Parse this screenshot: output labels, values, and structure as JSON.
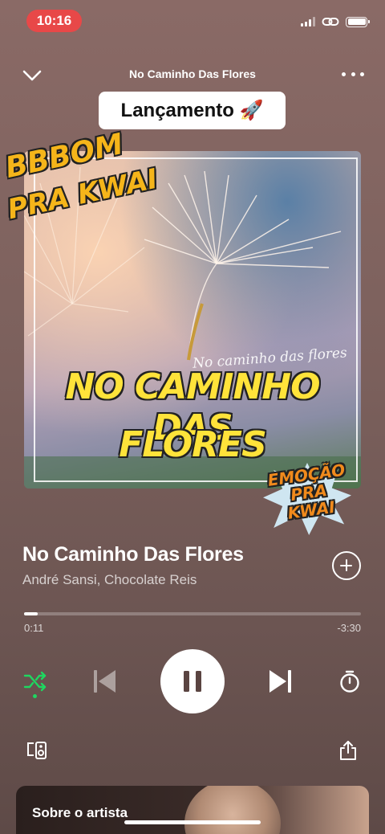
{
  "status_bar": {
    "time": "10:16"
  },
  "header": {
    "title": "No Caminho Das Flores"
  },
  "badge": {
    "label": "Lançamento 🚀"
  },
  "cover": {
    "script_text": "No caminho das flores",
    "title_line1": "NO CAMINHO DAS",
    "title_line2": "FLORES",
    "sticker_top_line1": "BBBOM",
    "sticker_top_line2": "PRA KWAI",
    "sticker_bottom_line1": "EMOÇÃO",
    "sticker_bottom_line2": "PRA KWAI"
  },
  "track": {
    "title": "No Caminho Das Flores",
    "artists": "André Sansi, Chocolate Reis"
  },
  "playback": {
    "elapsed": "0:11",
    "remaining": "-3:30",
    "progress_fraction": 0.04,
    "state": "playing",
    "shuffle_on": true
  },
  "about": {
    "title": "Sobre o artista"
  },
  "colors": {
    "accent": "#1ed760",
    "time_pill": "#e84848"
  },
  "icons": {
    "collapse": "chevron-down-icon",
    "more": "more-icon",
    "add": "add-icon",
    "shuffle": "shuffle-icon",
    "prev": "skip-previous-icon",
    "pause": "pause-icon",
    "next": "skip-next-icon",
    "timer": "sleep-timer-icon",
    "devices": "connect-device-icon",
    "share": "share-icon"
  }
}
